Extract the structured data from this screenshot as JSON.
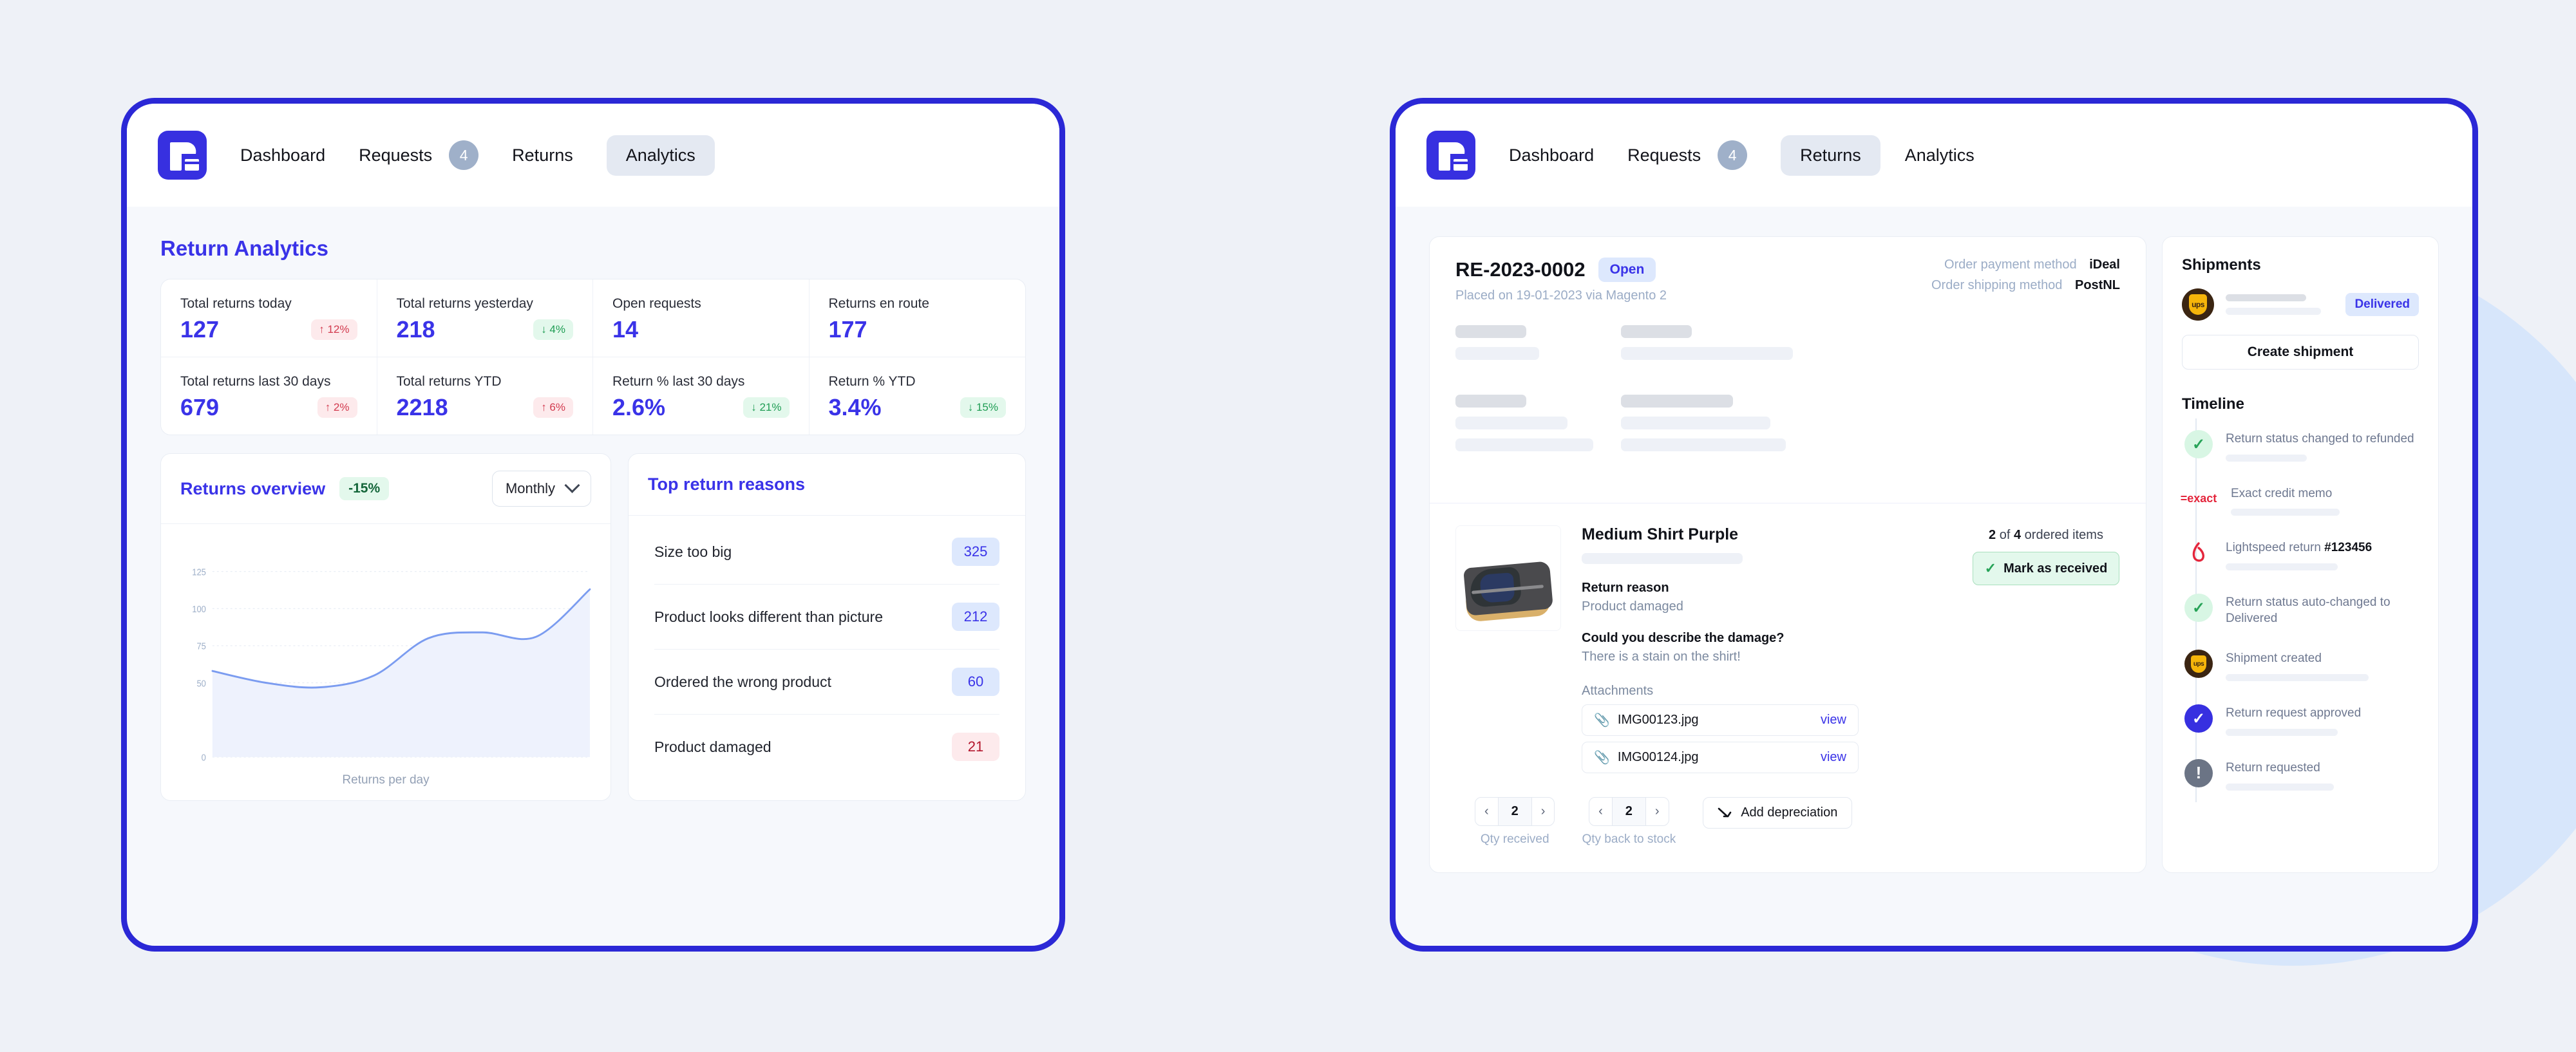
{
  "nav": {
    "logo_icon": "returnless-logo-icon",
    "items": [
      "Dashboard",
      "Requests",
      "Returns",
      "Analytics"
    ],
    "requests_badge": "4",
    "left_active": "Analytics",
    "right_active": "Returns"
  },
  "analytics": {
    "page_title": "Return Analytics",
    "stats": [
      {
        "label": "Total returns today",
        "value": "127",
        "delta": "12%",
        "dir": "up"
      },
      {
        "label": "Total returns yesterday",
        "value": "218",
        "delta": "4%",
        "dir": "down"
      },
      {
        "label": "Open requests",
        "value": "14",
        "delta": "",
        "dir": ""
      },
      {
        "label": "Returns en route",
        "value": "177",
        "delta": "",
        "dir": ""
      },
      {
        "label": "Total returns last 30 days",
        "value": "679",
        "delta": "2%",
        "dir": "up"
      },
      {
        "label": "Total returns YTD",
        "value": "2218",
        "delta": "6%",
        "dir": "up"
      },
      {
        "label": "Return % last 30 days",
        "value": "2.6%",
        "delta": "21%",
        "dir": "down"
      },
      {
        "label": "Return % YTD",
        "value": "3.4%",
        "delta": "15%",
        "dir": "down"
      }
    ],
    "chart_card": {
      "title": "Returns overview",
      "pct_chip": "-15%",
      "range_select": "Monthly",
      "select_icon": "chevron-down-icon"
    },
    "reasons_card": {
      "title": "Top return reasons",
      "rows": [
        {
          "label": "Size too big",
          "count": "325",
          "tone": "blue"
        },
        {
          "label": "Product looks different than picture",
          "count": "212",
          "tone": "blue"
        },
        {
          "label": "Ordered the wrong product",
          "count": "60",
          "tone": "blue"
        },
        {
          "label": "Product damaged",
          "count": "21",
          "tone": "red"
        }
      ]
    }
  },
  "chart_data": {
    "type": "area",
    "title": "Returns overview",
    "xlabel": "Returns per day",
    "ylabel": "",
    "ytick_labels": [
      "0",
      "50",
      "75",
      "100",
      "125"
    ],
    "ylim": [
      0,
      140
    ],
    "grid": true,
    "legend": null,
    "x": [
      0,
      1,
      2,
      3,
      4,
      5,
      6,
      7
    ],
    "values": [
      58,
      50,
      47,
      55,
      80,
      84,
      81,
      113
    ],
    "line_color": "#7b9cf0",
    "fill_color": "#eef2fd"
  },
  "detail": {
    "return_id": "RE-2023-0002",
    "status": "Open",
    "placed": "Placed on 19-01-2023 via Magento 2",
    "meta": [
      {
        "key": "Order payment method",
        "value": "iDeal"
      },
      {
        "key": "Order shipping method",
        "value": "PostNL"
      }
    ],
    "item": {
      "image_icon": "product-photo-bag",
      "name": "Medium Shirt Purple",
      "reason_label": "Return reason",
      "reason_value": "Product damaged",
      "question_label": "Could you describe the damage?",
      "question_value": "There is a stain on the shirt!",
      "attachments_label": "Attachments",
      "attachments": [
        {
          "icon": "paperclip-icon",
          "name": "IMG00123.jpg",
          "action": "view"
        },
        {
          "icon": "paperclip-icon",
          "name": "IMG00124.jpg",
          "action": "view"
        }
      ],
      "ordered_qty": "2",
      "ordered_total": "4",
      "ordered_suffix": "ordered items",
      "ordered_mid": "of",
      "mark_received": "Mark as received",
      "mark_icon": "check-icon"
    },
    "steppers": [
      {
        "prev_icon": "chevron-left-icon",
        "value": "2",
        "next_icon": "chevron-right-icon",
        "label": "Qty received"
      },
      {
        "prev_icon": "chevron-left-icon",
        "value": "2",
        "next_icon": "chevron-right-icon",
        "label": "Qty back to stock"
      }
    ],
    "depreciation": {
      "icon": "trend-down-icon",
      "label": "Add depreciation"
    }
  },
  "sidebar": {
    "shipments_title": "Shipments",
    "carrier_icon": "ups-logo-icon",
    "carrier_text": "ups",
    "shipment_status": "Delivered",
    "create_shipment": "Create shipment",
    "timeline_title": "Timeline",
    "timeline": [
      {
        "icon": "check-circle-green-icon",
        "tone": "green",
        "glyph": "✓",
        "text": "Return status changed to refunded",
        "bold": ""
      },
      {
        "icon": "exact-logo-icon",
        "tone": "exact",
        "glyph": "=exact",
        "text": "Exact credit memo",
        "bold": ""
      },
      {
        "icon": "lightspeed-logo-icon",
        "tone": "ls",
        "glyph": "⊕",
        "text": "Lightspeed return ",
        "bold": "#123456"
      },
      {
        "icon": "check-circle-green-icon",
        "tone": "green",
        "glyph": "✓",
        "text": "Return status auto-changed to Delivered",
        "bold": ""
      },
      {
        "icon": "ups-logo-icon",
        "tone": "ups",
        "glyph": "ups",
        "text": "Shipment created",
        "bold": ""
      },
      {
        "icon": "check-circle-blue-icon",
        "tone": "blue",
        "glyph": "✓",
        "text": "Return request approved",
        "bold": ""
      },
      {
        "icon": "exclamation-circle-icon",
        "tone": "grey",
        "glyph": "!",
        "text": "Return requested",
        "bold": ""
      }
    ]
  },
  "colors": {
    "brand": "#3730e0",
    "accent": "#3a33e8",
    "positive": "#1f9d54",
    "negative": "#d23a4e",
    "canvas": "#eef1f7",
    "deco": "#d7e6fb"
  }
}
